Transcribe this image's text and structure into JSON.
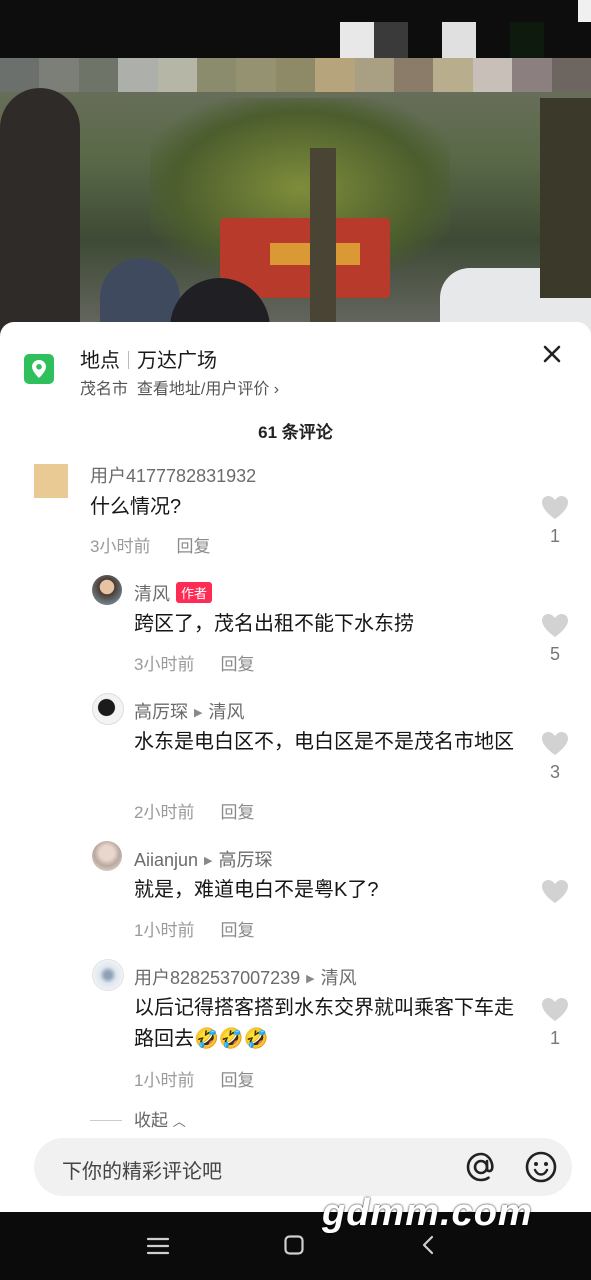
{
  "location": {
    "label": "地点",
    "name": "万达广场",
    "city": "茂名市",
    "link": "查看地址/用户评价 ›"
  },
  "comment_count": "61 条评论",
  "comments": [
    {
      "user": "用户4177782831932",
      "text": "什么情况?",
      "time": "3小时前",
      "reply": "回复",
      "likes": "1"
    },
    {
      "user": "清风",
      "badge": "作者",
      "text": "跨区了，茂名出租不能下水东捞",
      "time": "3小时前",
      "reply": "回复",
      "likes": "5"
    },
    {
      "user": "高厉琛",
      "reply_to": "清风",
      "text": "水东是电白区不，电白区是不是茂名市地区",
      "time": "2小时前",
      "reply": "回复",
      "likes": "3"
    },
    {
      "user": "Aiianjun",
      "reply_to": "高厉琛",
      "text": "就是，难道电白不是粤K了?",
      "time": "1小时前",
      "reply": "回复",
      "likes": ""
    },
    {
      "user": "用户8282537007239",
      "reply_to": "清风",
      "text": "以后记得搭客搭到水东交界就叫乘客下车走路回去🤣🤣🤣",
      "time": "1小时前",
      "reply": "回复",
      "likes": "1"
    }
  ],
  "collapse_label": "收起",
  "input": {
    "placeholder": "下你的精彩评论吧"
  },
  "watermark": "gdmm.com",
  "colors": {
    "accent": "#fe2c55",
    "location_green": "#2fbf5b"
  }
}
